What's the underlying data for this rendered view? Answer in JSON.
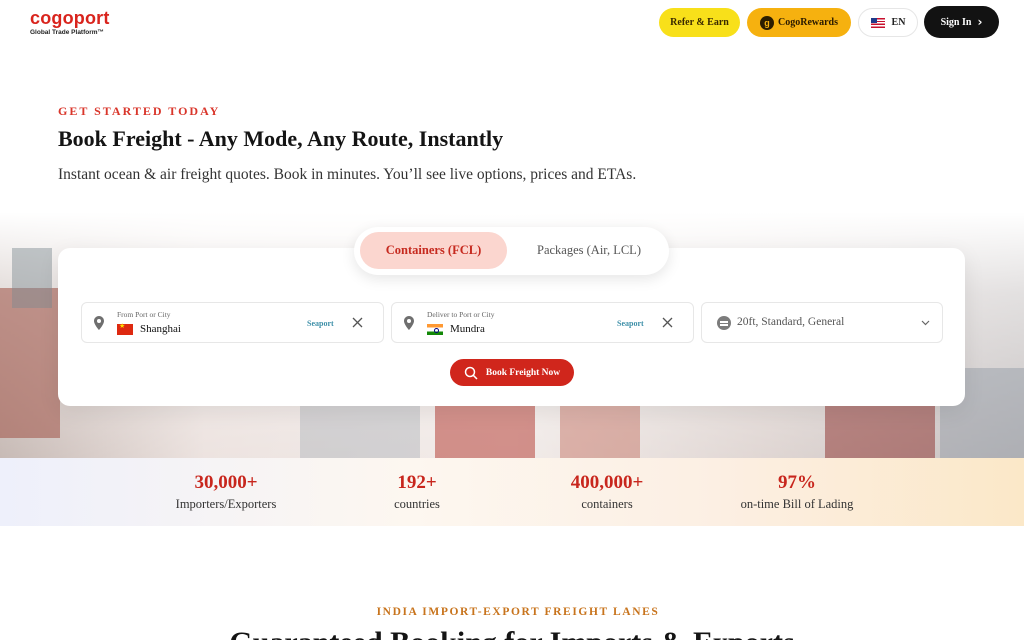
{
  "header": {
    "logo_word": "cogoport",
    "logo_tagline": "Global Trade Platform™",
    "refer_label": "Refer & Earn",
    "cogo_rewards_label": "CogoRewards",
    "language_label": "EN",
    "sign_in_label": "Sign In"
  },
  "hero": {
    "eyebrow": "GET STARTED TODAY",
    "title": "Book Freight - Any Mode, Any Route, Instantly",
    "subtitle": "Instant ocean & air freight quotes. Book in minutes. You’ll see live options, prices and ETAs."
  },
  "booking": {
    "tabs": [
      {
        "label": "Containers (FCL)",
        "active": true
      },
      {
        "label": "Packages (Air, LCL)",
        "active": false
      }
    ],
    "from": {
      "label": "From Port or City",
      "value": "Shanghai",
      "tag": "Seaport"
    },
    "to": {
      "label": "Deliver to Port or City",
      "value": "Mundra",
      "tag": "Seaport"
    },
    "cargo": {
      "value": "20ft, Standard, General"
    },
    "book_label": "Book Freight Now"
  },
  "stats": [
    {
      "value": "30,000+",
      "label": "Importers/Exporters"
    },
    {
      "value": "192+",
      "label": "countries"
    },
    {
      "value": "400,000+",
      "label": "containers"
    },
    {
      "value": "97%",
      "label": "on-time Bill of Lading"
    }
  ],
  "lanes": {
    "eyebrow": "INDIA IMPORT-EXPORT FREIGHT LANES",
    "title": "Guaranteed Booking for Imports & Exports"
  },
  "colors": {
    "brand": "#d9241d",
    "refer": "#f8e01a",
    "rewards": "#f6b10f",
    "active_tab": "#fbd6cf",
    "seaport_tag": "#3d8fa8"
  }
}
